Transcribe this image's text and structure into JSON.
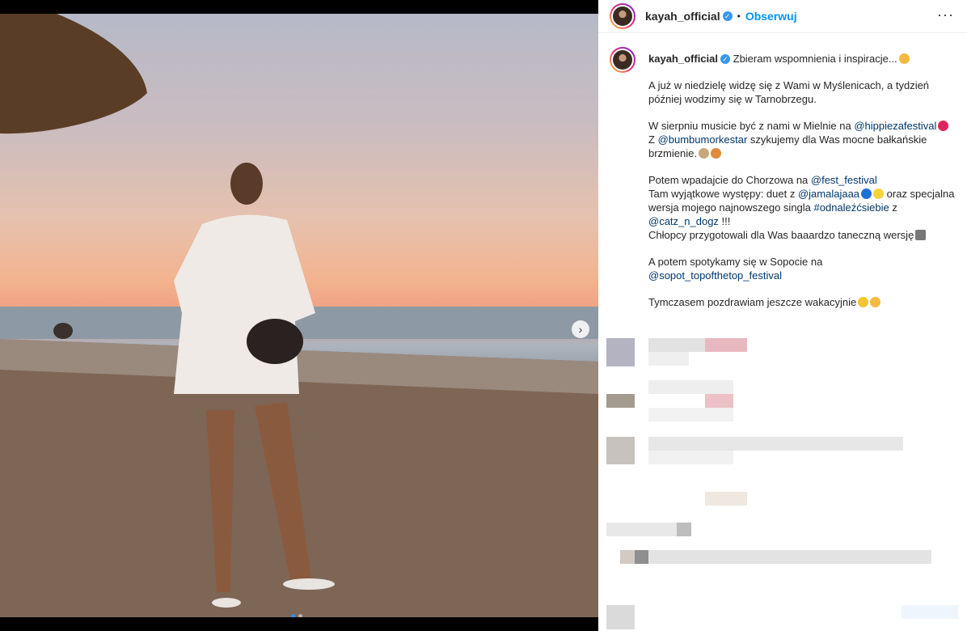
{
  "post": {
    "username": "kayah_official",
    "follow_label": "Obserwuj",
    "separator": "•",
    "more_label": "···",
    "next_label": "›"
  },
  "caption": {
    "username": "kayah_official",
    "headline": "Zbieram wspomnienia i inspiracje...",
    "p1": "A już w niedzielę widzę się z Wami w Myślenicach, a tydzień później wodzimy się w Tarnobrzegu.",
    "p2a": "W sierpniu musicie być z nami w Mielnie na ",
    "p2_m1": "@hippiezafestival",
    "p2b": "Z ",
    "p2_m2": "@bumbumorkestar",
    "p2c": " szykujemy dla Was mocne bałkańskie brzmienie.",
    "p3a": "Potem wpadajcie do Chorzowa na ",
    "p3_m1": "@fest_festival",
    "p3b": "Tam wyjątkowe występy: duet z ",
    "p3_m2": "@jamalajaaa",
    "p3c": " oraz specjalna wersja mojego najnowszego singla ",
    "p3_tag": "#odnaleźćsiebie",
    "p3d": " z ",
    "p3_m3": "@catz_n_dogz",
    "p3e": " !!!",
    "p3f": "Chłopcy przygotowali dla Was baaardzo taneczną wersję",
    "p4a": "A potem spotykamy się w Sopocie na",
    "p4_m1": "@sopot_topofthetop_festival",
    "p5": "Tymczasem pozdrawiam jeszcze wakacyjnie"
  },
  "colors": {
    "accent": "#0095f6",
    "mention": "#00376b"
  }
}
